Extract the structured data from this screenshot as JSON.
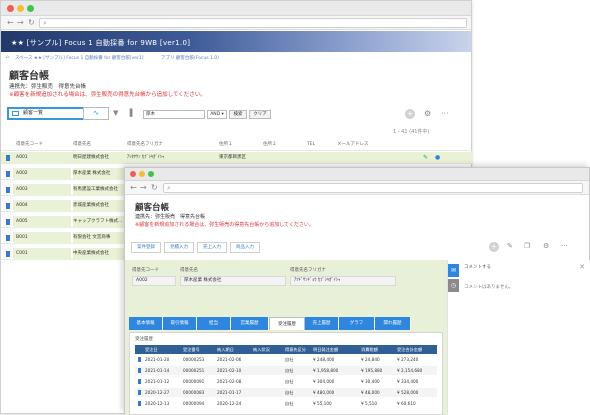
{
  "back": {
    "app_title": "★★ [サンプル] Focus 1 自動採番 for 9WB [ver1.0]",
    "breadcrumb": [
      "⌂",
      "スペース ★★ [サンプル] Focus 1 自動採番 for 顧客台帳[ver1]",
      "アプリ 顧客台帳(Focus 1.0)"
    ],
    "title": "顧客台帳",
    "subtitle": "連携先：弥生販売　得意先台帳",
    "warning": "※顧客を新規追加される場合は、弥生販売の得意先台帳から追加してください。",
    "view_name": "顧客一覧",
    "filter_field": "厚木",
    "filter_op": "AND ▾",
    "search_label": "検索",
    "clear_label": "クリア",
    "count_text": "1 - 41  (41件中)",
    "columns": [
      "得意先コード",
      "得意先名",
      "得意先名フリガナ",
      "住所１",
      "住所２",
      "TEL",
      "メールアドレス"
    ],
    "rows": [
      {
        "code": "A001",
        "name": "明日屋建株式会社",
        "kana": "ｱｼﾀﾔｹﾝ ｶﾌﾞｼｷｶﾞｲｼｬ",
        "addr1": "東京都目黒区",
        "addr2": "",
        "tel": "",
        "email": ""
      },
      {
        "code": "A002",
        "name": "厚木産業 株式会社",
        "kana": "",
        "addr1": "",
        "addr2": "",
        "tel": "",
        "email": ""
      },
      {
        "code": "A003",
        "name": "有馬建設工業株式会社",
        "kana": "",
        "addr1": "",
        "addr2": "",
        "tel": "",
        "email": ""
      },
      {
        "code": "A004",
        "name": "赤城産業株式会社",
        "kana": "",
        "addr1": "",
        "addr2": "",
        "tel": "",
        "email": ""
      },
      {
        "code": "A005",
        "name": "キャップクラフト株式...",
        "kana": "",
        "addr1": "",
        "addr2": "",
        "tel": "",
        "email": ""
      },
      {
        "code": "B001",
        "name": "有限会社 文宮商事",
        "kana": "",
        "addr1": "",
        "addr2": "",
        "tel": "",
        "email": ""
      },
      {
        "code": "C001",
        "name": "中央産業株式会社",
        "kana": "",
        "addr1": "",
        "addr2": "",
        "tel": "",
        "email": ""
      }
    ]
  },
  "front": {
    "title": "顧客台帳",
    "subtitle": "連携先：弥生販売　得意先台帳",
    "warning": "※顧客を新規追加される場合は、弥生販売の得意先台帳から追加してください。",
    "actions": [
      "案件登録",
      "見積入力",
      "売上入力",
      "商品入力"
    ],
    "field_labels": [
      "得意先コード",
      "得意先名",
      "得意先名フリガナ"
    ],
    "field_values": [
      "A002",
      "厚木産業 株式会社",
      "ｱﾂｷﾞｻﾝｷﾞｮｳ ｶﾌﾞｼｷｶﾞｲｼｬ"
    ],
    "tabs": [
      "基本情報",
      "取引情報",
      "担当",
      "営業履歴",
      "受注履歴",
      "売上履歴",
      "グラフ",
      "関わ履歴"
    ],
    "active_tab": "受注履歴",
    "subtable_title": "受注履歴",
    "order_columns": [
      "受注日",
      "受注番号",
      "納入期日",
      "納入状況",
      "得意先区分",
      "明日発注金額",
      "消費税額",
      "受注合計金額"
    ],
    "orders": [
      [
        "2021-01-20",
        "00000253",
        "2021-02-06",
        "",
        "自社",
        "¥ 248,400",
        "¥ 24,840",
        "¥ 273,240"
      ],
      [
        "2021-01-14",
        "00000251",
        "2021-02-10",
        "",
        "自社",
        "¥ 1,958,800",
        "¥ 195,880",
        "¥ 2,154,680"
      ],
      [
        "2021-01-12",
        "00000091",
        "2021-02-08",
        "",
        "自社",
        "¥ 304,000",
        "¥ 30,400",
        "¥ 334,400"
      ],
      [
        "2020-12-27",
        "00000083",
        "2021-01-17",
        "",
        "自社",
        "¥ 480,000",
        "¥ 48,000",
        "¥ 528,000"
      ],
      [
        "2020-12-13",
        "00000094",
        "2020-12-24",
        "",
        "自社",
        "¥ 55,100",
        "¥ 5,510",
        "¥ 60,610"
      ]
    ],
    "comment_header": "コメントする",
    "no_comment": "コメントはありません。"
  },
  "colors": {
    "accent": "#3498db",
    "header_dark": "#2f5f95",
    "warning": "#e03131",
    "detail_bg": "#e8f0d8",
    "row_highlight": "#e9f2d6"
  },
  "icons": [
    "back-icon",
    "forward-icon",
    "reload-icon",
    "search-icon",
    "home-icon",
    "graph-icon",
    "filter-icon",
    "chart-icon",
    "add-icon",
    "gear-icon",
    "more-icon",
    "file-icon",
    "edit-icon",
    "comment-icon",
    "history-icon",
    "close-icon"
  ]
}
